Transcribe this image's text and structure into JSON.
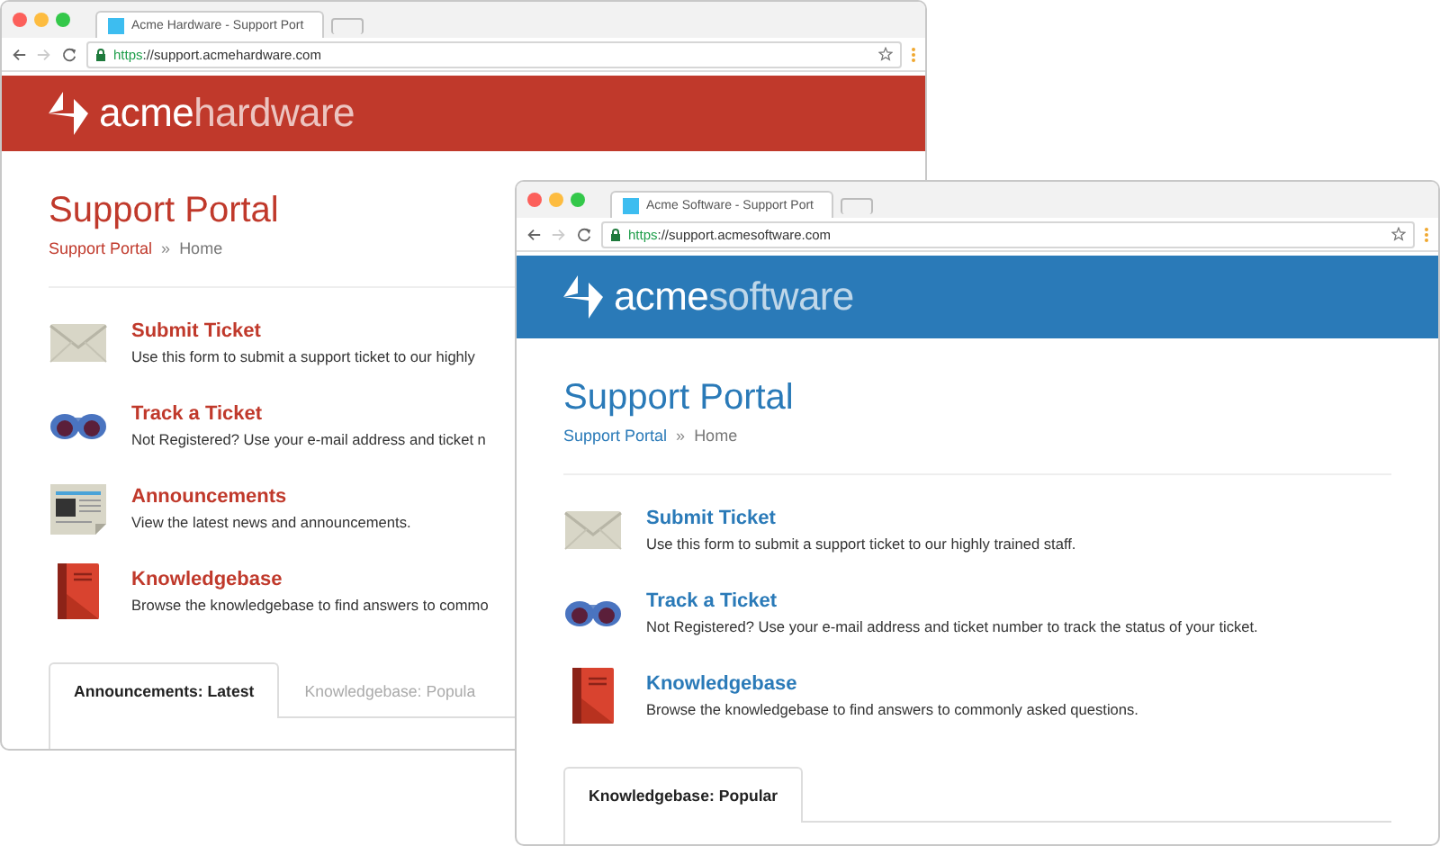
{
  "windows": [
    {
      "color": "#c0392b",
      "tab_title": "Acme Hardware - Support Port",
      "url_scheme": "https",
      "url_rest": "://support.acmehardware.com",
      "logo_strong": "acme",
      "logo_light": "hardware",
      "heading": "Support Portal",
      "breadcrumb": [
        "Support Portal",
        "»",
        "Home"
      ],
      "items": [
        {
          "kind": "envelope",
          "title": "Submit Ticket",
          "description": "Use this form to submit a support ticket to our highly"
        },
        {
          "kind": "binoculars",
          "title": "Track a Ticket",
          "description": "Not Registered? Use your e-mail address and ticket n"
        },
        {
          "kind": "newspaper",
          "title": "Announcements",
          "description": "View the latest news and announcements."
        },
        {
          "kind": "book",
          "title": "Knowledgebase",
          "description": "Browse the knowledgebase to find answers to commo"
        }
      ],
      "tabs": [
        {
          "label": "Announcements: Latest",
          "selected": true
        },
        {
          "label": "Knowledgebase: Popula",
          "selected": false
        }
      ]
    },
    {
      "color": "#2a7ab8",
      "tab_title": "Acme Software - Support Port",
      "url_scheme": "https",
      "url_rest": "://support.acmesoftware.com",
      "logo_strong": "acme",
      "logo_light": "software",
      "heading": "Support Portal",
      "breadcrumb": [
        "Support Portal",
        "»",
        "Home"
      ],
      "items": [
        {
          "kind": "envelope",
          "title": "Submit Ticket",
          "description": "Use this form to submit a support ticket to our highly trained staff."
        },
        {
          "kind": "binoculars",
          "title": "Track a Ticket",
          "description": "Not Registered? Use your e-mail address and ticket number to track the status of your ticket."
        },
        {
          "kind": "book",
          "title": "Knowledgebase",
          "description": "Browse the knowledgebase to find answers to commonly asked questions."
        }
      ],
      "tabs": [
        {
          "label": "Knowledgebase: Popular",
          "selected": true
        }
      ]
    }
  ]
}
